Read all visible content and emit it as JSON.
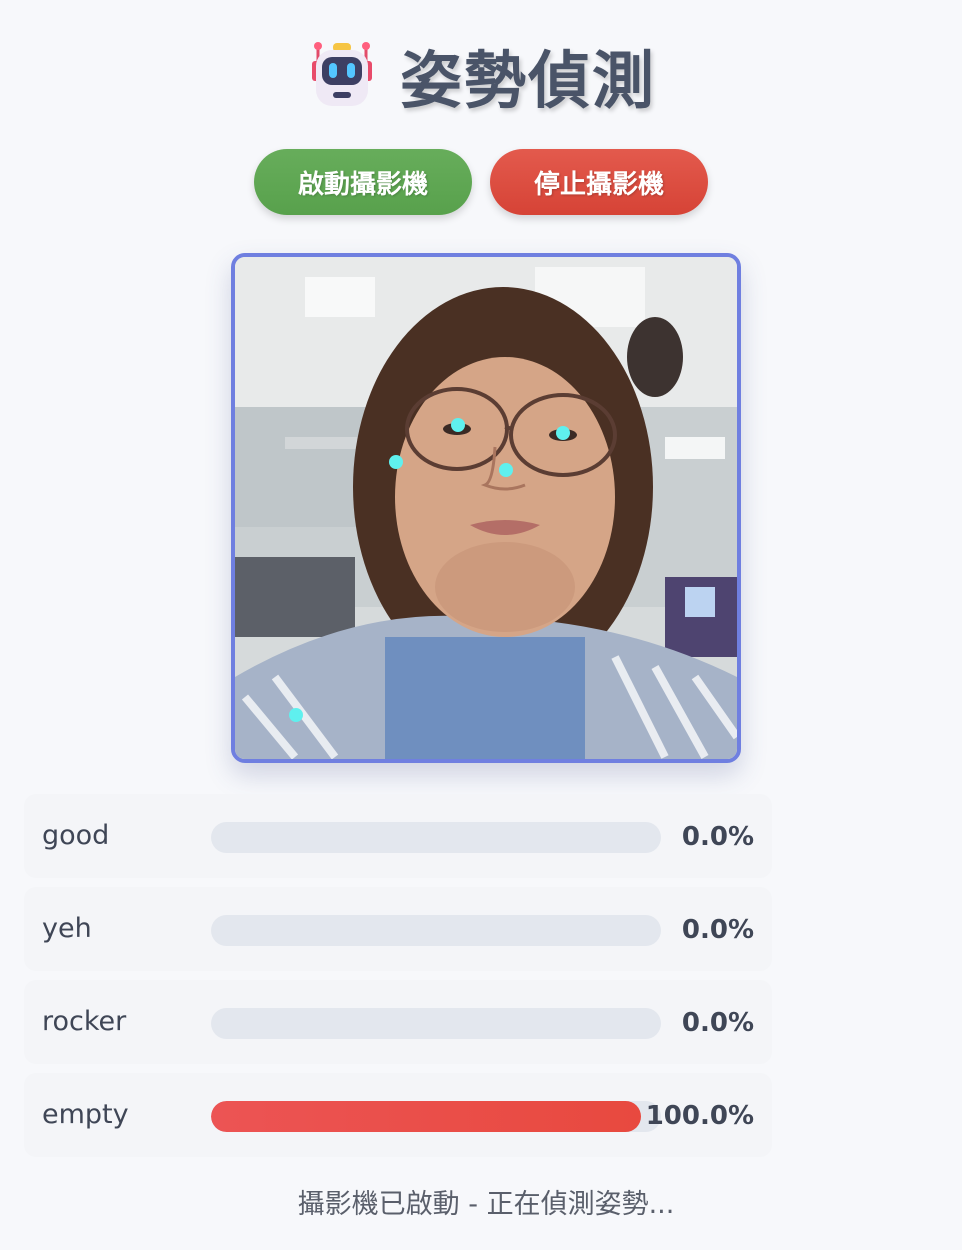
{
  "header": {
    "title": "姿勢偵測",
    "icon": "robot-icon"
  },
  "controls": {
    "start_label": "啟動攝影機",
    "stop_label": "停止攝影機",
    "start_color": "#5aa34e",
    "stop_color": "#d94a3d"
  },
  "camera": {
    "border_color": "#6f7fe0",
    "keypoint_color": "#5ff0ee"
  },
  "predictions": [
    {
      "label": "good",
      "value": "0.0%",
      "fraction": 0.0
    },
    {
      "label": "yeh",
      "value": "0.0%",
      "fraction": 0.0
    },
    {
      "label": "rocker",
      "value": "0.0%",
      "fraction": 0.0
    },
    {
      "label": "empty",
      "value": "100.0%",
      "fraction": 1.0
    }
  ],
  "status": {
    "text": "攝影機已啟動 - 正在偵測姿勢..."
  }
}
